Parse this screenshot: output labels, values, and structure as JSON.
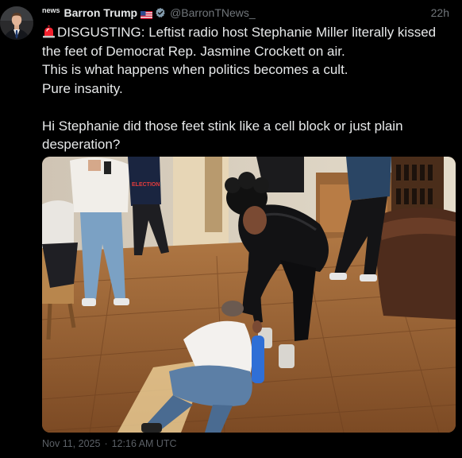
{
  "author": {
    "news_tag": "news",
    "display_name": "Barron Trump",
    "flag_icon": "us-flag-icon",
    "verified_icon": "verified-badge-icon",
    "handle": "@BarronTNews_",
    "relative_time": "22h"
  },
  "tweet": {
    "lead_icon": "siren-icon",
    "paragraphs": [
      "DISGUSTING: Leftist radio host Stephanie Miller literally kissed the feet of Democrat Rep. Jasmine Crockett on air.",
      "This is what happens when politics becomes a cult.",
      "Pure insanity.",
      "Hi Stephanie did those feet stink like a cell block or just plain desperation?"
    ]
  },
  "media": {
    "photo_sign_text": "ELECTION"
  },
  "footer": {
    "date": "Nov 11, 2025",
    "time": "12:16 AM UTC",
    "separator": "·"
  },
  "colors": {
    "background": "#000000",
    "text": "#e7e9ea",
    "secondary": "#71767b",
    "verified": "#829aab",
    "siren": "#f4212e"
  }
}
